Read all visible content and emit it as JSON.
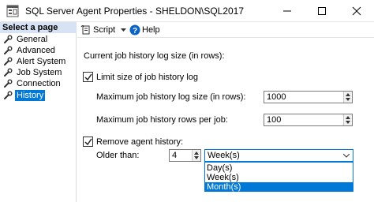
{
  "window": {
    "title": "SQL Server Agent Properties - SHELDON\\SQL2017"
  },
  "left_pane": {
    "header": "Select a page",
    "items": [
      {
        "label": "General",
        "icon": "wrench-icon",
        "selected": false
      },
      {
        "label": "Advanced",
        "icon": "wrench-icon",
        "selected": false
      },
      {
        "label": "Alert System",
        "icon": "wrench-icon",
        "selected": false
      },
      {
        "label": "Job System",
        "icon": "wrench-icon",
        "selected": false
      },
      {
        "label": "Connection",
        "icon": "wrench-icon",
        "selected": false
      },
      {
        "label": "History",
        "icon": "wrench-icon",
        "selected": true
      }
    ]
  },
  "toolbar": {
    "script_label": "Script",
    "help_label": "Help"
  },
  "form": {
    "current_size_label": "Current job history log size (in rows):",
    "limit_label": "Limit size of job history log",
    "limit_checked": true,
    "max_log_size_label": "Maximum job history log size (in rows):",
    "max_log_size_value": "1000",
    "max_rows_per_job_label": "Maximum job history rows per job:",
    "max_rows_per_job_value": "100",
    "remove_label": "Remove agent history:",
    "remove_checked": true,
    "older_than_label": "Older than:",
    "older_than_value": "4",
    "unit_selected": "Week(s)",
    "unit_options": [
      "Day(s)",
      "Week(s)",
      "Month(s)"
    ],
    "unit_highlighted": "Month(s)"
  },
  "colors": {
    "accent": "#0078d7",
    "header_bg": "#d7e3f4"
  }
}
